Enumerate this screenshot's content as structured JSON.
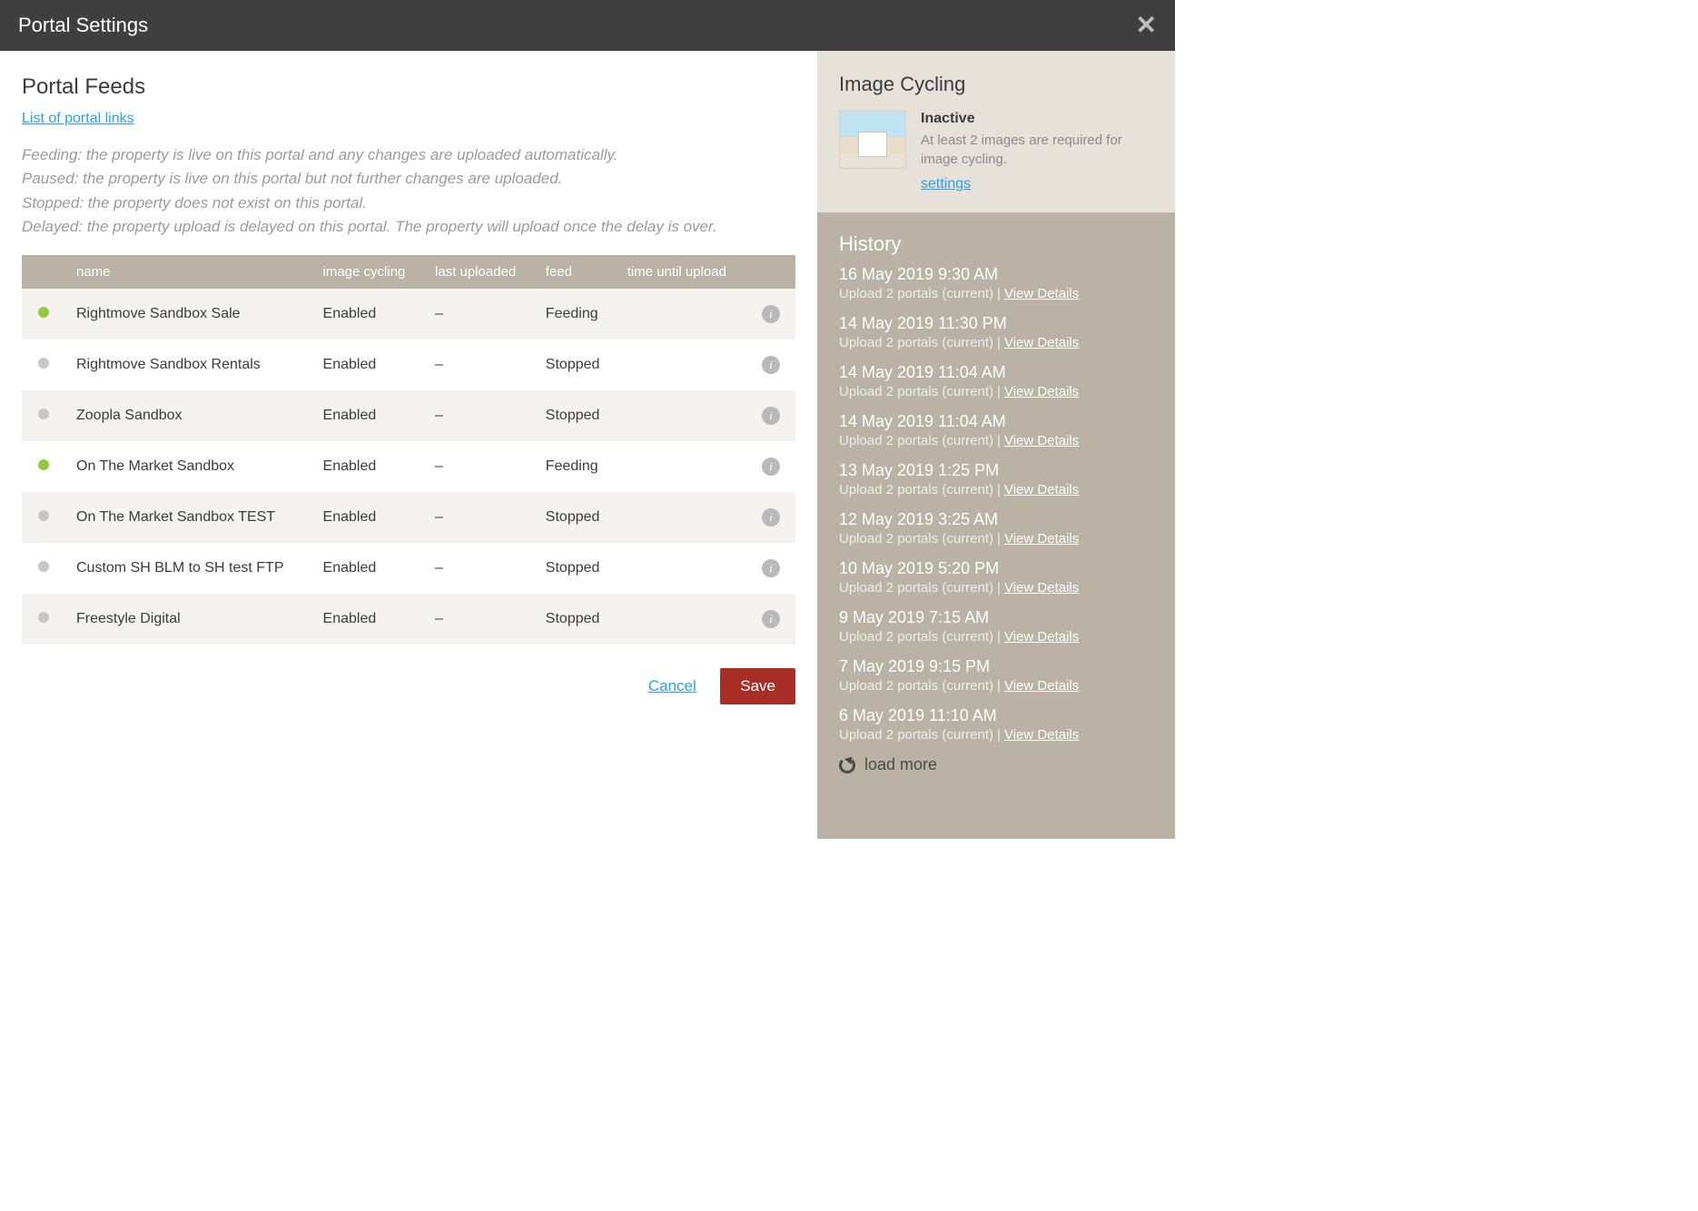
{
  "header": {
    "title": "Portal Settings"
  },
  "main": {
    "heading": "Portal Feeds",
    "links_text": "List of portal links",
    "descriptions": [
      "Feeding: the property is live on this portal and any changes are uploaded automatically.",
      "Paused: the property is live on this portal but not further changes are uploaded.",
      "Stopped: the property does not exist on this portal.",
      "Delayed: the property upload is delayed on this portal. The property will upload once the delay is over."
    ],
    "columns": {
      "name": "name",
      "image_cycling": "image cycling",
      "last_uploaded": "last uploaded",
      "feed": "feed",
      "time_until_upload": "time until upload"
    },
    "feeds": [
      {
        "active": true,
        "name": "Rightmove Sandbox Sale",
        "image_cycling": "Enabled",
        "last_uploaded": "–",
        "feed": "Feeding",
        "time_until_upload": ""
      },
      {
        "active": false,
        "name": "Rightmove Sandbox Rentals",
        "image_cycling": "Enabled",
        "last_uploaded": "–",
        "feed": "Stopped",
        "time_until_upload": ""
      },
      {
        "active": false,
        "name": "Zoopla Sandbox",
        "image_cycling": "Enabled",
        "last_uploaded": "–",
        "feed": "Stopped",
        "time_until_upload": ""
      },
      {
        "active": true,
        "name": "On The Market Sandbox",
        "image_cycling": "Enabled",
        "last_uploaded": "–",
        "feed": "Feeding",
        "time_until_upload": ""
      },
      {
        "active": false,
        "name": "On The Market Sandbox TEST",
        "image_cycling": "Enabled",
        "last_uploaded": "–",
        "feed": "Stopped",
        "time_until_upload": ""
      },
      {
        "active": false,
        "name": "Custom SH BLM to SH test FTP",
        "image_cycling": "Enabled",
        "last_uploaded": "–",
        "feed": "Stopped",
        "time_until_upload": ""
      },
      {
        "active": false,
        "name": "Freestyle Digital",
        "image_cycling": "Enabled",
        "last_uploaded": "–",
        "feed": "Stopped",
        "time_until_upload": ""
      }
    ],
    "actions": {
      "cancel": "Cancel",
      "save": "Save"
    }
  },
  "image_cycling": {
    "heading": "Image Cycling",
    "status": "Inactive",
    "description": "At least 2 images are required for image cycling.",
    "settings_label": "settings"
  },
  "history": {
    "heading": "History",
    "items": [
      {
        "time": "16 May 2019 9:30 AM",
        "summary": "Upload 2 portals (current)",
        "link": "View Details"
      },
      {
        "time": "14 May 2019 11:30 PM",
        "summary": "Upload 2 portals (current)",
        "link": "View Details"
      },
      {
        "time": "14 May 2019 11:04 AM",
        "summary": "Upload 2 portals (current)",
        "link": "View Details"
      },
      {
        "time": "14 May 2019 11:04 AM",
        "summary": "Upload 2 portals (current)",
        "link": "View Details"
      },
      {
        "time": "13 May 2019 1:25 PM",
        "summary": "Upload 2 portals (current)",
        "link": "View Details"
      },
      {
        "time": "12 May 2019 3:25 AM",
        "summary": "Upload 2 portals (current)",
        "link": "View Details"
      },
      {
        "time": "10 May 2019 5:20 PM",
        "summary": "Upload 2 portals (current)",
        "link": "View Details"
      },
      {
        "time": "9 May 2019 7:15 AM",
        "summary": "Upload 2 portals (current)",
        "link": "View Details"
      },
      {
        "time": "7 May 2019 9:15 PM",
        "summary": "Upload 2 portals (current)",
        "link": "View Details"
      },
      {
        "time": "6 May 2019 11:10 AM",
        "summary": "Upload 2 portals (current)",
        "link": "View Details"
      }
    ],
    "load_more": "load more"
  }
}
